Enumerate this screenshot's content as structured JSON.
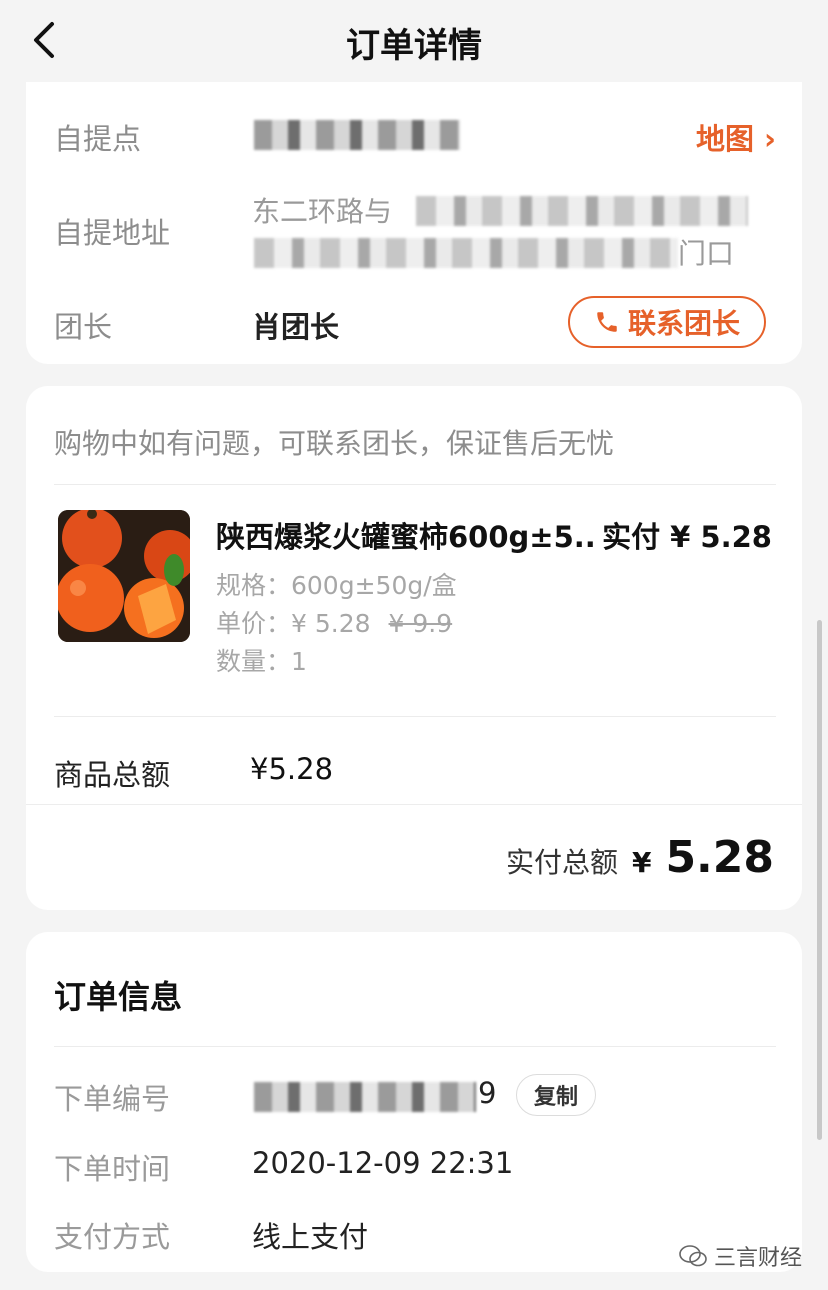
{
  "header": {
    "title": "订单详情"
  },
  "pickup": {
    "point_label": "自提点",
    "map_label": "地图 ›",
    "address_label": "自提地址",
    "address_start": "东二环路与",
    "address_end": "门口",
    "leader_label": "团长",
    "leader_name": "肖团长",
    "contact_label": "联系团长"
  },
  "goods": {
    "notice": "购物中如有问题，可联系团长，保证售后无忧",
    "product": {
      "name": "陕西爆浆火罐蜜柿600g±5...",
      "paid": "实付 ¥ 5.28",
      "spec": "规格：600g±50g/盒",
      "unit_price": "单价：¥ 5.28",
      "original_price": "¥ 9.9",
      "quantity": "数量：1"
    },
    "subtotal_label": "商品总额",
    "subtotal_value": "¥5.28",
    "total_label": "实付总额",
    "total_currency": "¥",
    "total_value": "5.28"
  },
  "order_info": {
    "title": "订单信息",
    "number_label": "下单编号",
    "number_suffix": "9",
    "copy_label": "复制",
    "time_label": "下单时间",
    "time_value": "2020-12-09 22:31",
    "payment_label": "支付方式",
    "payment_value": "线上支付"
  },
  "watermark": "三言财经",
  "colors": {
    "accent": "#e6612a",
    "background": "#f4f4f4",
    "card": "#ffffff"
  }
}
